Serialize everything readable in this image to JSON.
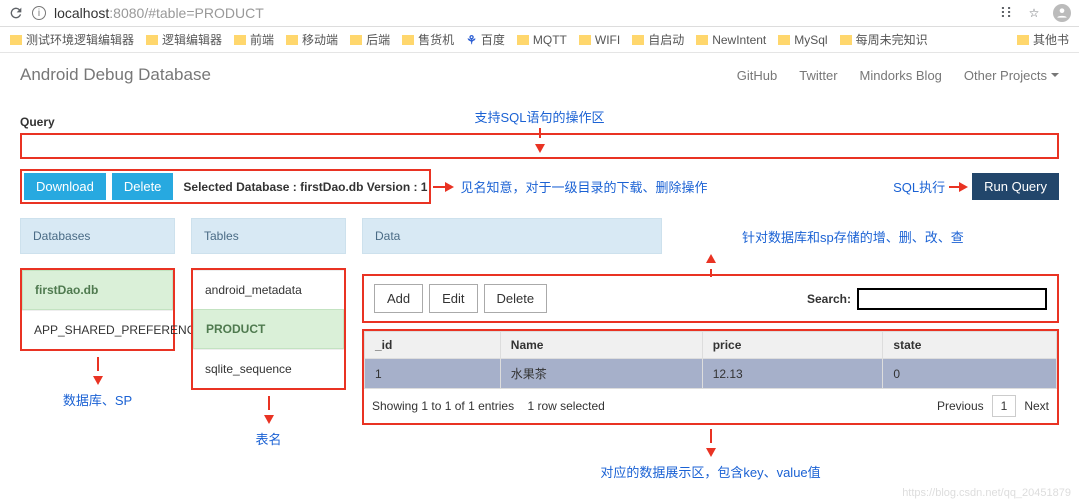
{
  "browser": {
    "url_host": "localhost",
    "url_port": ":8080",
    "url_path": "/#table=PRODUCT"
  },
  "bookmarks": [
    "测试环境逻辑编辑器",
    "逻辑编辑器",
    "前端",
    "移动端",
    "后端",
    "售货机",
    "百度",
    "MQTT",
    "WIFI",
    "自启动",
    "NewIntent",
    "MySql",
    "每周未完知识",
    "其他书"
  ],
  "header": {
    "title": "Android Debug Database",
    "nav": [
      "GitHub",
      "Twitter",
      "Mindorks Blog",
      "Other Projects"
    ]
  },
  "annotations": {
    "sql_area": "支持SQL语句的操作区",
    "download_delete": "见名知意，对于一级目录的下载、删除操作",
    "sql_exec": "SQL执行",
    "crud": "针对数据库和sp存储的增、删、改、查",
    "db_sp": "数据库、SP",
    "tables": "表名",
    "data_area": "对应的数据展示区，包含key、value值"
  },
  "query": {
    "label": "Query"
  },
  "buttons": {
    "download": "Download",
    "delete": "Delete",
    "selected": "Selected Database : firstDao.db Version : 1",
    "run": "Run Query",
    "add": "Add",
    "edit": "Edit",
    "del2": "Delete",
    "search": "Search:"
  },
  "panels": {
    "databases": "Databases",
    "tables": "Tables",
    "data": "Data"
  },
  "db_items": [
    {
      "name": "firstDao.db",
      "selected": true
    },
    {
      "name": "APP_SHARED_PREFERENCES",
      "selected": false
    }
  ],
  "table_items": [
    {
      "name": "android_metadata",
      "selected": false
    },
    {
      "name": "PRODUCT",
      "selected": true
    },
    {
      "name": "sqlite_sequence",
      "selected": false
    }
  ],
  "table": {
    "columns": [
      "_id",
      "Name",
      "price",
      "state"
    ],
    "rows": [
      {
        "_id": "1",
        "Name": "水果茶",
        "price": "12.13",
        "state": "0",
        "selected": true
      }
    ],
    "showing": "Showing 1 to 1 of 1 entries",
    "selected_info": "1 row selected",
    "prev": "Previous",
    "page": "1",
    "next": "Next"
  },
  "watermark": "https://blog.csdn.net/qq_20451879"
}
